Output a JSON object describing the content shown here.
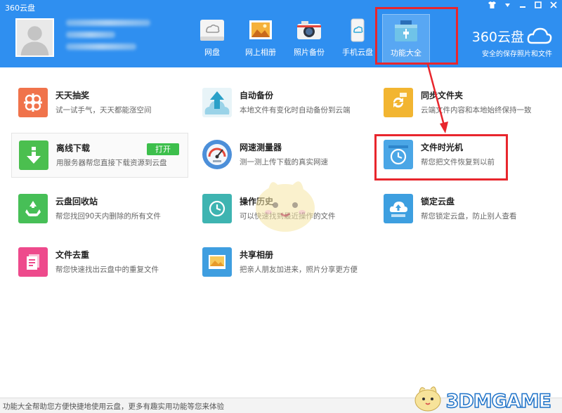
{
  "app_title": "360云盘",
  "window_controls": [
    "shirt-icon",
    "caret-icon",
    "minimize-icon",
    "maximize-icon",
    "close-icon"
  ],
  "nav": [
    {
      "label": "网盘",
      "icon": "cloud-drive-icon"
    },
    {
      "label": "网上相册",
      "icon": "photo-album-icon"
    },
    {
      "label": "照片备份",
      "icon": "camera-icon"
    },
    {
      "label": "手机云盘",
      "icon": "phone-cloud-icon"
    },
    {
      "label": "功能大全",
      "icon": "toolbox-icon",
      "active": true
    }
  ],
  "brand": {
    "name": "360云盘",
    "slogan": "安全的保存照片和文件"
  },
  "features": [
    {
      "title": "天天抽奖",
      "desc": "试一试手气，天天都能涨空间",
      "icon": "gift-icon",
      "color": "#f0734b"
    },
    {
      "title": "自动备份",
      "desc": "本地文件有变化时自动备份到云端",
      "icon": "upload-cloud-icon",
      "color": "#4cb7d8"
    },
    {
      "title": "同步文件夹",
      "desc": "云端文件内容和本地始终保持一致",
      "icon": "sync-folder-icon",
      "color": "#f2b531"
    },
    {
      "title": "离线下载",
      "desc": "用服务器帮您直接下载资源到云盘",
      "icon": "download-icon",
      "color": "#4bbf4f",
      "button": "打开"
    },
    {
      "title": "网速测量器",
      "desc": "测一测上传下载的真实网速",
      "icon": "speedometer-icon",
      "color": "#4c8fd9"
    },
    {
      "title": "文件时光机",
      "desc": "帮您把文件恢复到以前",
      "icon": "clock-icon",
      "color": "#4aa6e6"
    },
    {
      "title": "云盘回收站",
      "desc": "帮您找回90天内删除的所有文件",
      "icon": "recycle-icon",
      "color": "#47bf57"
    },
    {
      "title": "操作历史",
      "desc": "可以快速找到最近操作的文件",
      "icon": "history-icon",
      "color": "#3eb4b1"
    },
    {
      "title": "锁定云盘",
      "desc": "帮您锁定云盘，防止别人查看",
      "icon": "lock-cloud-icon",
      "color": "#3d9fe0"
    },
    {
      "title": "文件去重",
      "desc": "帮您快速找出云盘中的重复文件",
      "icon": "duplicate-file-icon",
      "color": "#ee4a8c"
    },
    {
      "title": "共享相册",
      "desc": "把亲人朋友加进来，照片分享更方便",
      "icon": "shared-album-icon",
      "color": "#3f9ee0"
    }
  ],
  "footer_text": "功能大全帮助您方便快捷地使用云盘，更多有趣实用功能等您来体验",
  "watermark": "3DMGAME",
  "colors": {
    "header_bg": "#2f8ff0",
    "highlight": "#e8262d",
    "open_button": "#3dbf4c"
  }
}
